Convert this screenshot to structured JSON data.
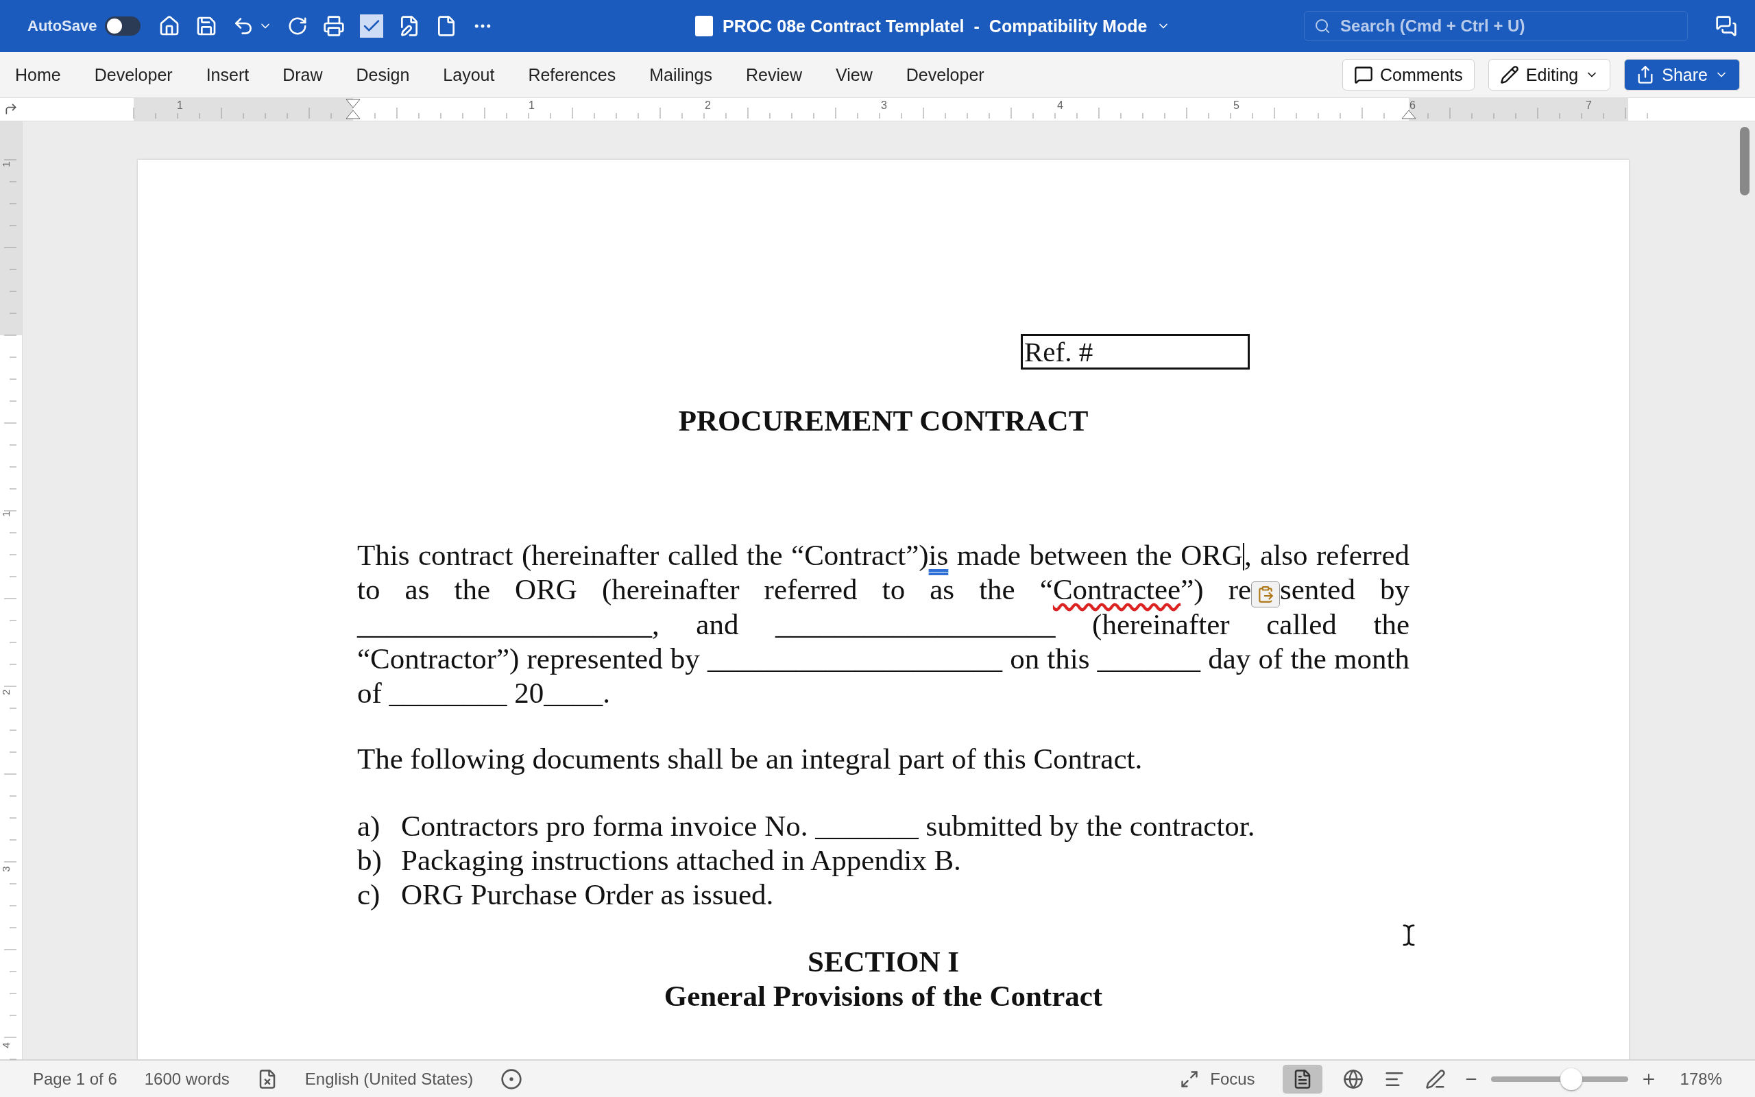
{
  "title_bar": {
    "autosave": {
      "label": "AutoSave",
      "on": false
    },
    "document_title": "PROC 08e Contract Templatel",
    "separator": "-",
    "mode": "Compatibility Mode",
    "search": {
      "placeholder": "Search (Cmd + Ctrl + U)"
    }
  },
  "ribbon_tabs": [
    "Home",
    "Developer",
    "Insert",
    "Draw",
    "Design",
    "Layout",
    "References",
    "Mailings",
    "Review",
    "View",
    "Developer"
  ],
  "ribbon_buttons": {
    "comments": "Comments",
    "editing": "Editing",
    "share": "Share"
  },
  "ruler": {
    "labels": [
      "1",
      "1",
      "2",
      "3",
      "4",
      "5",
      "6",
      "7"
    ]
  },
  "vertical_ruler": {
    "labels": [
      "1",
      "1",
      "2",
      "3",
      "4"
    ]
  },
  "document": {
    "ref_box": "Ref. #",
    "title": "PROCUREMENT CONTRACT",
    "intro": [
      {
        "kind": "text",
        "text": "This contract (hereinafter called the “Contract”)"
      },
      {
        "kind": "grammar",
        "text": "is"
      },
      {
        "kind": "text",
        "text": " made between the ORG"
      },
      {
        "kind": "cursor"
      },
      {
        "kind": "text",
        "text": ", also referred to as the ORG (hereinafter referred to as the “"
      },
      {
        "kind": "spelling",
        "text": "Contractee"
      },
      {
        "kind": "text",
        "text": "”) re"
      },
      {
        "kind": "paste"
      },
      {
        "kind": "text",
        "text": "sented by ____________________, and ___________________ (hereinafter called the “Contractor”) represented by ____________________ on this _______ day of the month of ________ 20____."
      }
    ],
    "paragraph": "The following documents shall be an integral part of this Contract.",
    "list": [
      {
        "marker": "a)",
        "text": "Contractors pro forma invoice No. _______ submitted by the contractor."
      },
      {
        "marker": "b)",
        "text": "Packaging instructions attached in Appendix B."
      },
      {
        "marker": "c)",
        "text": "ORG Purchase Order as issued."
      }
    ],
    "section": {
      "number": "SECTION I",
      "title": "General Provisions of the Contract"
    }
  },
  "status_bar": {
    "page": "Page 1 of 6",
    "words": "1600 words",
    "language": "English (United States)",
    "focus": "Focus",
    "zoom": {
      "level": 0.58,
      "reading": "178%"
    }
  }
}
